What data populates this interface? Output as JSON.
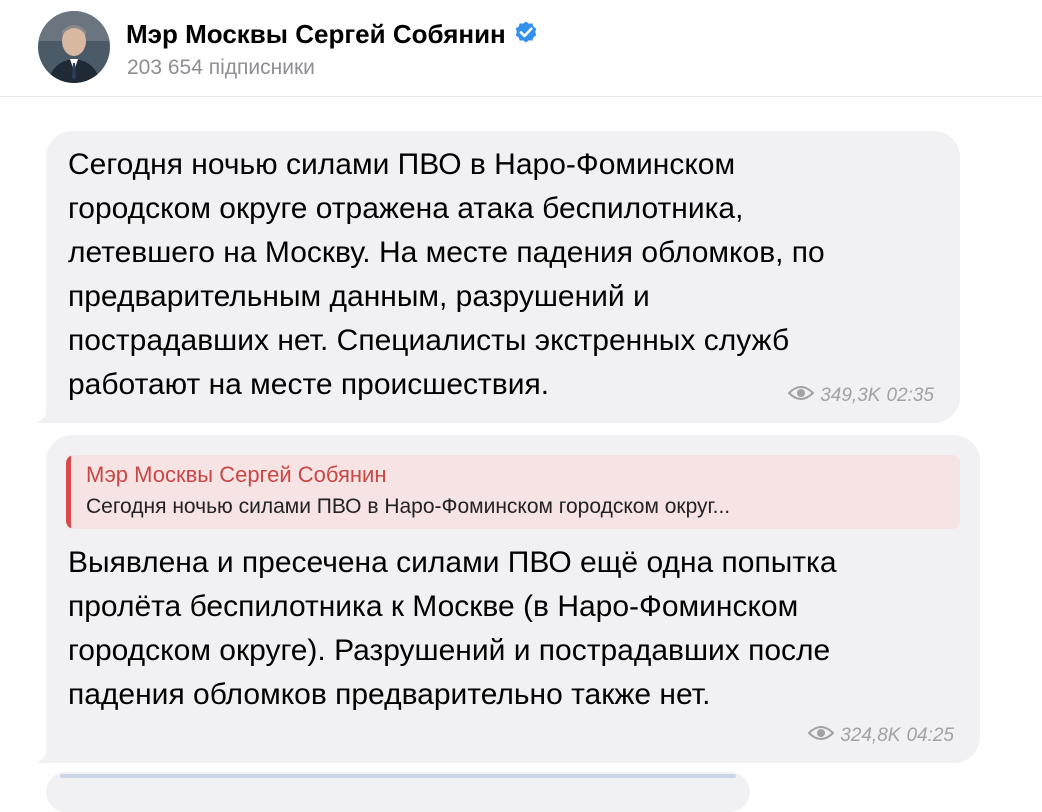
{
  "channel": {
    "name": "Мэр Москвы Сергей Собянин",
    "subscribers": "203 654 підписники",
    "avatar_icon": "avatar-photo",
    "verified_icon": "verified-badge-icon",
    "accent_color": "#3390ec"
  },
  "messages": [
    {
      "text": "Сегодня ночью силами ПВО в Наро-Фоминском\nгородском округе отражена атака беспилотника,\nлетевшего на Москву. На месте падения обломков, по\nпредварительным данным, разрушений и\nпострадавших нет. Специалисты экстренных служб\nработают на месте происшествия.",
      "views": "349,3K",
      "time": "02:35"
    },
    {
      "reply": {
        "author": "Мэр Москвы Сергей Собянин",
        "snippet": "Сегодня ночью силами ПВО в Наро-Фоминском городском округ..."
      },
      "text": "Выявлена и пресечена силами ПВО ещё одна попытка\nпролёта беспилотника к Москве (в Наро-Фоминском\nгородском округе). Разрушений и пострадавших после\nпадения обломков предварительно также нет.",
      "views": "324,8K",
      "time": "04:25"
    }
  ],
  "colors": {
    "bubble_bg": "#f1f1f3",
    "reply_accent": "#d94b4b",
    "meta_text": "#a2a2a6"
  }
}
